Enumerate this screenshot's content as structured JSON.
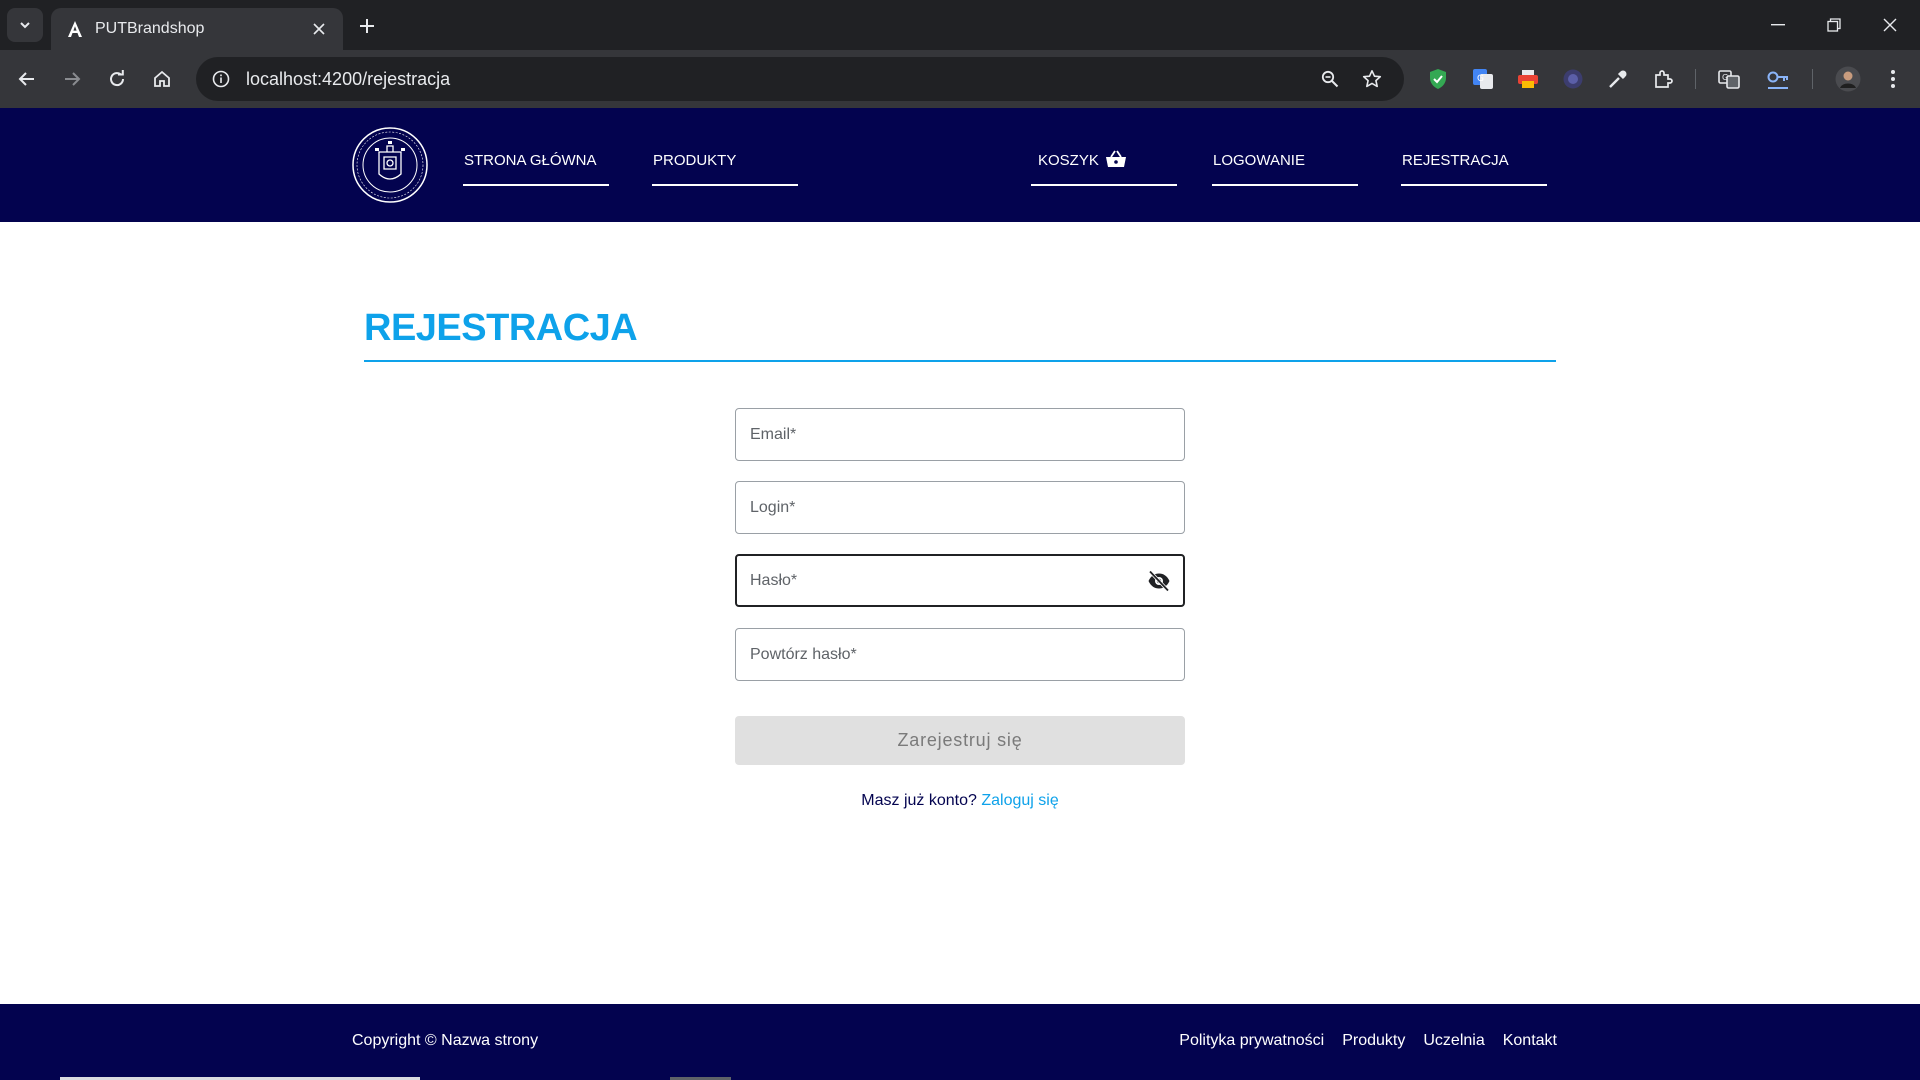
{
  "browser": {
    "tab_title": "PUTBrandshop",
    "url": "localhost:4200/rejestracja"
  },
  "header": {
    "logo_text": "POLITECHNIKA POZNAŃSKA · POZNAN UNIVERSITY OF TECHNOLOGY",
    "nav": [
      {
        "label": "STRONA GŁÓWNA"
      },
      {
        "label": "PRODUKTY"
      },
      {
        "label": "KOSZYK"
      },
      {
        "label": "LOGOWANIE"
      },
      {
        "label": "REJESTRACJA"
      }
    ]
  },
  "main": {
    "title": "REJESTRACJA",
    "fields": {
      "email": {
        "placeholder": "Email*"
      },
      "login": {
        "placeholder": "Login*"
      },
      "password": {
        "placeholder": "Hasło*"
      },
      "repeat_password": {
        "placeholder": "Powtórz hasło*"
      }
    },
    "submit_label": "Zarejestruj się",
    "login_prompt": "Masz już konto?",
    "login_link": "Zaloguj się"
  },
  "footer": {
    "copyright": "Copyright © Nazwa strony",
    "links": [
      "Polityka prywatności",
      "Produkty",
      "Uczelnia",
      "Kontakt"
    ]
  },
  "colors": {
    "brand_navy": "#03034f",
    "accent_blue": "#0ea2ea"
  },
  "icons": {
    "cart": "basket-icon",
    "password_toggle": "eye-off-icon"
  }
}
